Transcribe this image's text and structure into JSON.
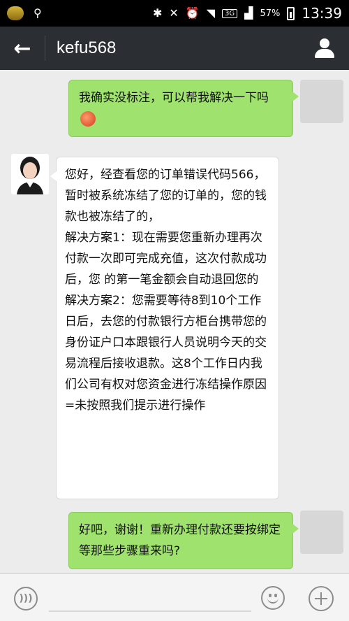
{
  "status_bar": {
    "battery": "57%",
    "time": "13:39",
    "network_tag": "3G"
  },
  "header": {
    "title": "kefu568",
    "back_icon": "back-arrow-icon",
    "profile_icon": "person-icon"
  },
  "messages": [
    {
      "side": "out",
      "text": "我确实没标注，可以帮我解决一下吗",
      "emoji": "grimace-emoji"
    },
    {
      "side": "in",
      "text": "您好，经查看您的订单错误代码566，暂时被系统冻结了您的订单的，您的钱款也被冻结了的，\n解决方案1：现在需要您重新办理再次付款一次即可完成充值，这次付款成功后，您 的第一笔金额会自动退回您的\n解决方案2：您需要等待8到10个工作日后，去您的付款银行方柜台携带您的身份证户口本跟银行人员说明今天的交易流程后接收退款。这8个工作日内我们公司有权对您资金进行冻结操作原因=未按照我们提示进行操作"
    },
    {
      "side": "out",
      "text": "好吧，谢谢！重新办理付款还要按绑定等那些步骤重来吗?"
    }
  ],
  "input_bar": {
    "voice_icon": "voice-icon",
    "emoji_icon": "emoji-icon",
    "plus_icon": "plus-icon"
  }
}
